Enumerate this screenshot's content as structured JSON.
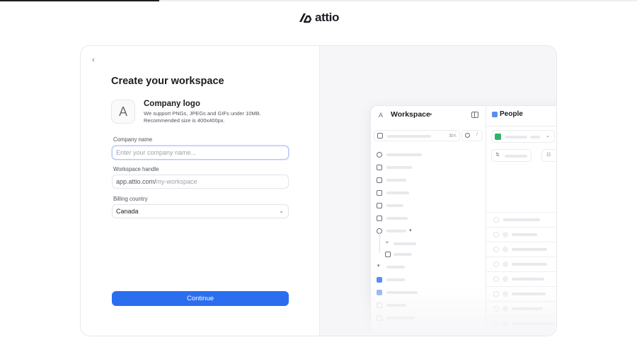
{
  "brand": {
    "name": "attio"
  },
  "onboarding": {
    "progress": 0.25
  },
  "form": {
    "back_label": "‹",
    "title": "Create your workspace",
    "logo": {
      "avatar_letter": "A",
      "heading": "Company logo",
      "help_line1": "We support PNGs, JPEGs and GIFs under 10MB.",
      "help_line2": "Recommended size is 400x400px."
    },
    "company_name": {
      "label": "Company name",
      "value": "",
      "placeholder": "Enter your company name..."
    },
    "workspace_handle": {
      "label": "Workspace handle",
      "prefix": "app.attio.com/",
      "placeholder": "my-workspace"
    },
    "billing_country": {
      "label": "Billing country",
      "value": "Canada"
    },
    "continue_label": "Continue"
  },
  "preview": {
    "workspace_letter": "A",
    "workspace_name": "Workspace",
    "search_shortcut": "⌘K",
    "search_slash": "/",
    "object_title": "People"
  },
  "colors": {
    "primary": "#2b6ef0",
    "accent_blue": "#5b8def",
    "accent_green": "#2fb36b"
  }
}
